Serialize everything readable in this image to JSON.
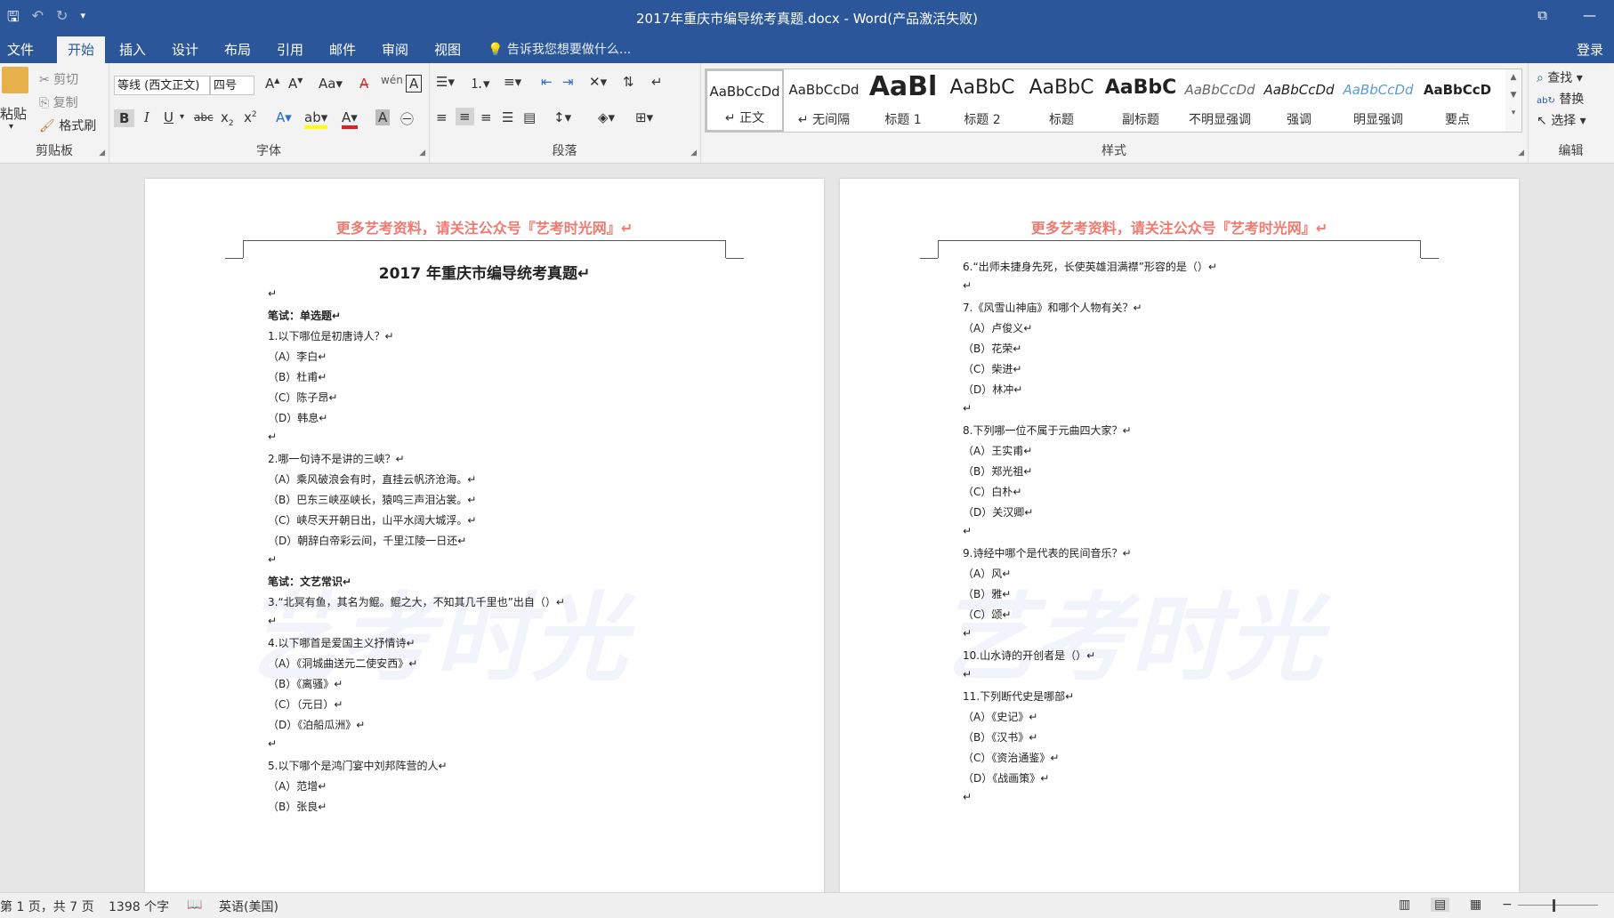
{
  "window": {
    "title": "2017年重庆市编导统考真题.docx - Word(产品激活失败)",
    "login": "登录"
  },
  "tabs": [
    "文件",
    "开始",
    "插入",
    "设计",
    "布局",
    "引用",
    "邮件",
    "审阅",
    "视图"
  ],
  "tell_me": "告诉我您想要做什么...",
  "clipboard": {
    "paste": "粘贴",
    "cut": "剪切",
    "copy": "复制",
    "format_painter": "格式刷",
    "label": "剪贴板"
  },
  "font": {
    "name": "等线 (西文正文)",
    "size": "四号",
    "label": "字体",
    "case_btn": "Aa"
  },
  "paragraph": {
    "label": "段落"
  },
  "styles": {
    "label": "样式",
    "items": [
      {
        "sample": "AaBbCcDd",
        "name": "正文"
      },
      {
        "sample": "AaBbCcDd",
        "name": "无间隔"
      },
      {
        "sample": "AaBl",
        "name": "标题 1"
      },
      {
        "sample": "AaBbC",
        "name": "标题 2"
      },
      {
        "sample": "AaBbC",
        "name": "标题"
      },
      {
        "sample": "AaBbC",
        "name": "副标题"
      },
      {
        "sample": "AaBbCcDd",
        "name": "不明显强调"
      },
      {
        "sample": "AaBbCcDd",
        "name": "强调"
      },
      {
        "sample": "AaBbCcDd",
        "name": "明显强调"
      },
      {
        "sample": "AaBbCcD",
        "name": "要点"
      }
    ]
  },
  "editing": {
    "find": "查找",
    "replace": "替换",
    "select": "选择",
    "label": "编辑"
  },
  "header_text": "更多艺考资料，请关注公众号『艺考时光网』↵",
  "watermark": "艺考时光",
  "page1": {
    "title": "2017 年重庆市编导统考真题↵",
    "lines": [
      {
        "t": "↵",
        "b": false
      },
      {
        "t": "笔试：单选题↵",
        "b": true
      },
      {
        "t": "1.以下哪位是初唐诗人？↵",
        "b": false
      },
      {
        "t": "（A）李白↵",
        "b": false
      },
      {
        "t": "（B）杜甫↵",
        "b": false
      },
      {
        "t": "（C）陈子昂↵",
        "b": false
      },
      {
        "t": "（D）韩息↵",
        "b": false
      },
      {
        "t": "↵",
        "b": false
      },
      {
        "t": "2.哪一句诗不是讲的三峡？↵",
        "b": false
      },
      {
        "t": "（A）乘风破浪会有时，直挂云帆济沧海。↵",
        "b": false
      },
      {
        "t": "（B）巴东三峡巫峡长，猿鸣三声泪沾裳。↵",
        "b": false
      },
      {
        "t": "（C）峡尽天开朝日出，山平水阔大城浮。↵",
        "b": false
      },
      {
        "t": "（D）朝辞白帝彩云间，千里江陵一日还↵",
        "b": false
      },
      {
        "t": "↵",
        "b": false
      },
      {
        "t": "笔试：文艺常识↵",
        "b": true
      },
      {
        "t": "3.“北冥有鱼，其名为鲲。鲲之大，不知其几千里也”出自（）↵",
        "b": false
      },
      {
        "t": "↵",
        "b": false
      },
      {
        "t": "4.以下哪首是爱国主义抒情诗↵",
        "b": false
      },
      {
        "t": "（A）《洞城曲送元二使安西》↵",
        "b": false
      },
      {
        "t": "（B）《离骚》↵",
        "b": false
      },
      {
        "t": "（C）（元日）↵",
        "b": false
      },
      {
        "t": "（D）《泊船瓜洲》↵",
        "b": false
      },
      {
        "t": "↵",
        "b": false
      },
      {
        "t": "5.以下哪个是鸿门宴中刘邦阵营的人↵",
        "b": false
      },
      {
        "t": "（A）范增↵",
        "b": false
      },
      {
        "t": "（B）张良↵",
        "b": false
      }
    ]
  },
  "page2": {
    "lines": [
      "6.“出师未捷身先死，长使英雄泪满襟”形容的是（）↵",
      "↵",
      "7.《风雪山神庙》和哪个人物有关？↵",
      "（A）卢俊义↵",
      "（B）花荣↵",
      "（C）柴进↵",
      "（D）林冲↵",
      "↵",
      "8.下列哪一位不属于元曲四大家？↵",
      "（A）王实甫↵",
      "（B）郑光祖↵",
      "（C）白朴↵",
      "（D）关汉卿↵",
      "↵",
      "9.诗经中哪个是代表的民间音乐？↵",
      "（A）风↵",
      "（B）雅↵",
      "（C）颂↵",
      "↵",
      "10.山水诗的开创者是（）↵",
      "↵",
      "11.下列断代史是哪部↵",
      "（A）《史记》↵",
      "（B）《汉书》↵",
      "（C）《资治通鉴》↵",
      "（D）《战画策》↵",
      "↵"
    ]
  },
  "status": {
    "page": "第 1 页，共 7 页",
    "words": "1398 个字",
    "language": "英语(美国)"
  }
}
